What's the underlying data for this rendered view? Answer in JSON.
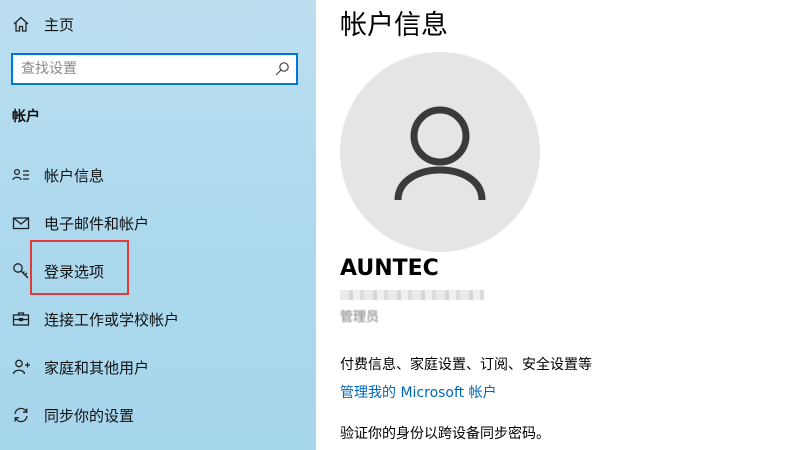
{
  "sidebar": {
    "home_label": "主页",
    "search": {
      "placeholder": "查找设置"
    },
    "section_title": "帐户",
    "items": [
      {
        "label": "帐户信息",
        "icon": "account-info-icon"
      },
      {
        "label": "电子邮件和帐户",
        "icon": "mail-icon"
      },
      {
        "label": "登录选项",
        "icon": "key-icon"
      },
      {
        "label": "连接工作或学校帐户",
        "icon": "briefcase-icon"
      },
      {
        "label": "家庭和其他用户",
        "icon": "add-person-icon"
      },
      {
        "label": "同步你的设置",
        "icon": "sync-icon"
      }
    ]
  },
  "main": {
    "title": "帐户信息",
    "username": "AUNTEC",
    "role": "管理员",
    "billing_text": "付费信息、家庭设置、订阅、安全设置等",
    "manage_link": "管理我的 Microsoft 帐户",
    "verify_text": "验证你的身份以跨设备同步密码。"
  },
  "colors": {
    "accent": "#0078d7",
    "link": "#0067b8",
    "highlight": "#e03a3a",
    "sidebar_bg": "#aed9ee"
  }
}
